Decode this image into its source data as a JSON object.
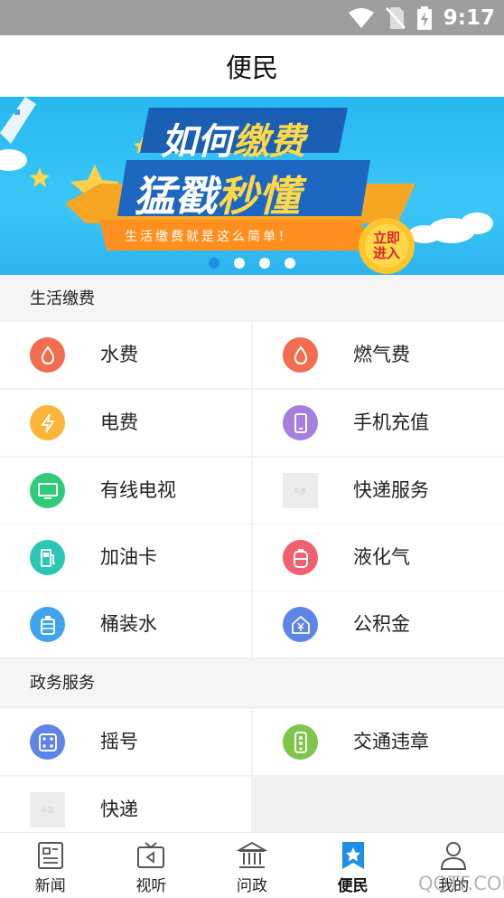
{
  "status": {
    "time": "9:17"
  },
  "header": {
    "title": "便民"
  },
  "banner": {
    "line1_a": "如何",
    "line1_b": "缴费",
    "line2_a": "猛戳",
    "line2_b": "秒懂",
    "subtitle": "生活缴费就是这么简单！",
    "cta_line1": "立即",
    "cta_line2": "进入",
    "page_count": 4,
    "active_page": 1
  },
  "sections": [
    {
      "title": "生活缴费",
      "items": [
        {
          "label": "水费",
          "icon": "water-drop-icon",
          "color": "#f26d4f"
        },
        {
          "label": "燃气费",
          "icon": "gas-flame-icon",
          "color": "#f26d4f"
        },
        {
          "label": "电费",
          "icon": "lightning-icon",
          "color": "#fbb63a"
        },
        {
          "label": "手机充值",
          "icon": "phone-icon",
          "color": "#a57ee0"
        },
        {
          "label": "有线电视",
          "icon": "tv-icon",
          "color": "#2fcb78"
        },
        {
          "label": "快递服务",
          "icon": "placeholder-icon",
          "color": "#ececec"
        },
        {
          "label": "加油卡",
          "icon": "fuel-icon",
          "color": "#2ac7b6"
        },
        {
          "label": "液化气",
          "icon": "gas-tank-icon",
          "color": "#f16071"
        },
        {
          "label": "桶装水",
          "icon": "water-bucket-icon",
          "color": "#3fa4ee"
        },
        {
          "label": "公积金",
          "icon": "yuan-house-icon",
          "color": "#5f84e8"
        }
      ]
    },
    {
      "title": "政务服务",
      "items": [
        {
          "label": "摇号",
          "icon": "dice-icon",
          "color": "#5f84e8"
        },
        {
          "label": "交通违章",
          "icon": "traffic-light-icon",
          "color": "#7cc64a"
        },
        {
          "label": "快递",
          "icon": "placeholder-icon",
          "color": "#ececec"
        }
      ]
    }
  ],
  "placeholder_text": "众览",
  "tabs": [
    {
      "label": "新闻",
      "icon": "news-icon"
    },
    {
      "label": "视听",
      "icon": "media-icon"
    },
    {
      "label": "问政",
      "icon": "government-icon"
    },
    {
      "label": "便民",
      "icon": "star-bookmark-icon",
      "active": true
    },
    {
      "label": "我的",
      "icon": "user-icon"
    }
  ],
  "watermark": "QQTF.COM",
  "colors": {
    "accent": "#1f8ee6",
    "status_bar": "#9e9e9e",
    "banner_blue": "#2bb4ee"
  }
}
